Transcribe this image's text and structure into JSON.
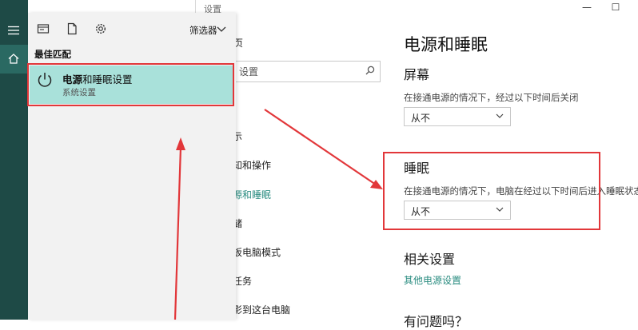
{
  "settings": {
    "window_title": "设置",
    "minimize_glyph": "—",
    "maximize_glyph": "☐",
    "left_nav": {
      "home_partial": "页",
      "search_placeholder": "设置",
      "items": [
        "示",
        "知和操作",
        "源和睡眠",
        "储",
        "板电脑模式",
        "任务",
        "影到这台电脑"
      ]
    },
    "page_title": "电源和睡眠",
    "screen": {
      "heading": "屏幕",
      "description": "在接通电源的情况下，经过以下时间后关闭",
      "value": "从不"
    },
    "sleep": {
      "heading": "睡眠",
      "description": "在接通电源的情况下，电脑在经过以下时间后进入睡眠状态",
      "value": "从不"
    },
    "related": {
      "heading": "相关设置",
      "link": "其他电源设置"
    },
    "bottom_partial": "有问题吗？"
  },
  "start_panel": {
    "filter_label": "筛选器",
    "best_match_label": "最佳匹配",
    "result": {
      "title_bold": "电源",
      "title_rest": "和睡眠设置",
      "subtitle": "系统设置"
    }
  },
  "colors": {
    "rail": "#1e4a46",
    "accent": "#2a8c80",
    "result_highlight": "#a9e1da",
    "annotation_red": "#e2373a"
  },
  "icons": [
    "hamburger-icon",
    "home-icon",
    "grid-view-icon",
    "document-icon",
    "gear-icon",
    "chevron-down-icon",
    "power-icon",
    "search-icon"
  ]
}
